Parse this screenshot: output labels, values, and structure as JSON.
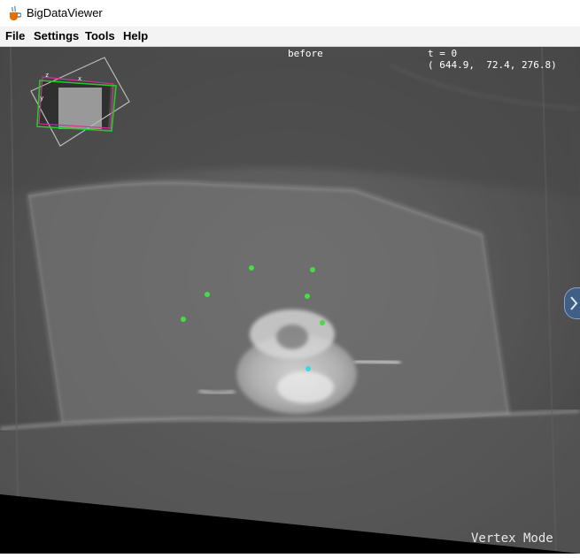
{
  "window": {
    "title": "BigDataViewer",
    "icon": "java-coffee-cup-icon"
  },
  "menu": {
    "items": [
      "File",
      "Settings",
      "Tools",
      "Help"
    ]
  },
  "viewer": {
    "source_name": "before",
    "timepoint": "t = 0",
    "coordinates": "( 644.9,  72.4, 276.8)",
    "mode": "Vertex Mode",
    "navigator_axes": {
      "x": "x",
      "y": "y",
      "z": "z"
    },
    "colors": {
      "landmark": "#44dd44",
      "active_landmark": "#33dddd",
      "navigator_slice": "#22cc22",
      "navigator_view": "#cc3399"
    },
    "landmarks_count_shown": 7
  }
}
